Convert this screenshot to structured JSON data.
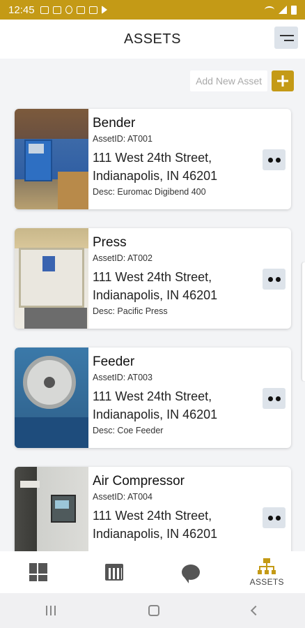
{
  "status_bar": {
    "time": "12:45"
  },
  "header": {
    "title": "ASSETS"
  },
  "actions": {
    "add_label": "Add New Asset"
  },
  "assets": [
    {
      "name": "Bender",
      "asset_id": "AssetID: AT001",
      "address_line1": "111 West 24th Street,",
      "address_line2": "Indianapolis, IN 46201",
      "desc": "Desc: Euromac Digibend 400"
    },
    {
      "name": "Press",
      "asset_id": "AssetID: AT002",
      "address_line1": "111 West 24th Street,",
      "address_line2": "Indianapolis, IN 46201",
      "desc": "Desc: Pacific Press"
    },
    {
      "name": "Feeder",
      "asset_id": "AssetID: AT003",
      "address_line1": "111 West 24th Street,",
      "address_line2": "Indianapolis, IN 46201",
      "desc": "Desc: Coe Feeder"
    },
    {
      "name": "Air Compressor",
      "asset_id": "AssetID: AT004",
      "address_line1": "111 West 24th Street,",
      "address_line2": "Indianapolis, IN 46201",
      "desc": ""
    }
  ],
  "bottom_nav": {
    "items": [
      {
        "icon": "dashboard-icon",
        "label": ""
      },
      {
        "icon": "calendar-icon",
        "label": ""
      },
      {
        "icon": "chat-icon",
        "label": ""
      },
      {
        "icon": "assets-icon",
        "label": "ASSETS"
      }
    ]
  },
  "colors": {
    "accent": "#c49a16",
    "background": "#f3f4f6",
    "card": "#ffffff",
    "button_bg": "#dde3ea"
  }
}
